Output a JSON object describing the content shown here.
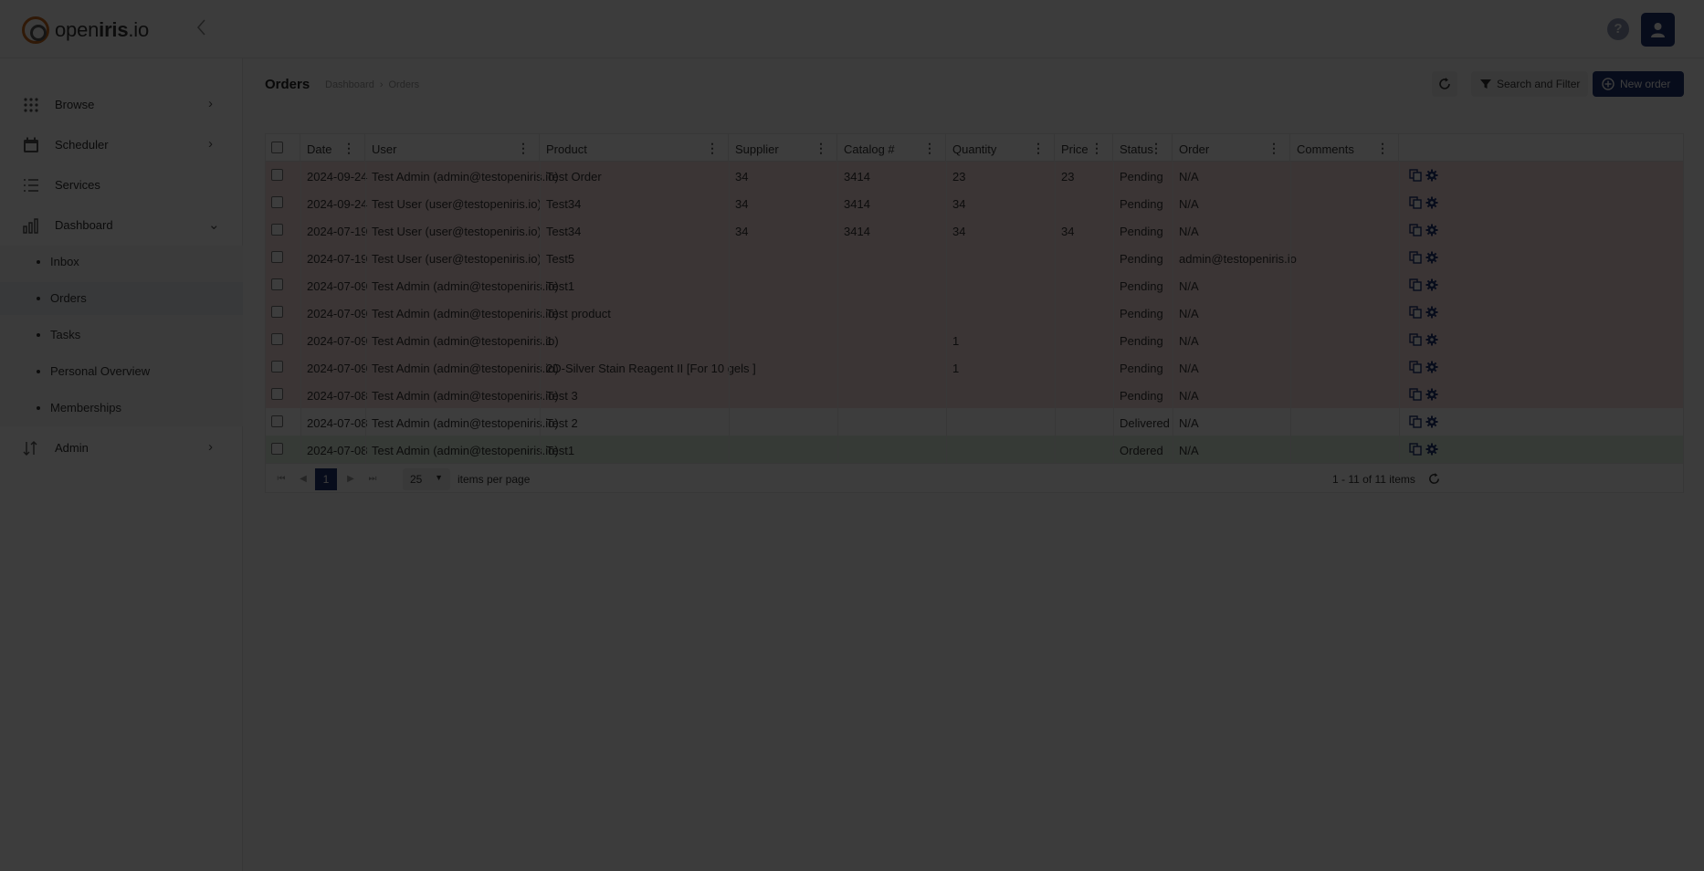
{
  "header": {
    "brand_light": "open",
    "brand_bold": "iris",
    "brand_suffix": ".io",
    "collapse_icon": "chevron-left-icon",
    "help_label": "?",
    "user_icon": "user-icon"
  },
  "sidebar": {
    "items": [
      {
        "label": "Browse",
        "icon": "grid-dots-icon",
        "chevron": "›"
      },
      {
        "label": "Scheduler",
        "icon": "calendar-icon",
        "chevron": "›"
      },
      {
        "label": "Services",
        "icon": "list-icon",
        "chevron": ""
      },
      {
        "label": "Dashboard",
        "icon": "bar-chart-icon",
        "chevron": "⌄"
      },
      {
        "label": "Admin",
        "icon": "sort-icon",
        "chevron": "›"
      }
    ],
    "dashboard_sub": [
      "Inbox",
      "Orders",
      "Tasks",
      "Personal Overview",
      "Memberships"
    ],
    "active_sub": "Orders"
  },
  "page": {
    "title": "Orders",
    "breadcrumb": [
      "Dashboard",
      "›",
      "Orders"
    ]
  },
  "toolbar": {
    "refresh_icon": "refresh-icon",
    "filter_label": "Search and Filter",
    "new_label": "New order"
  },
  "grid": {
    "columns": [
      "Date",
      "User",
      "Product",
      "Supplier",
      "Catalog #",
      "Quantity",
      "Price",
      "Status",
      "Order",
      "Comments"
    ],
    "rows": [
      {
        "date": "2024-09-24",
        "user": "Test Admin (admin@testopeniris.io)",
        "product": "Test Order",
        "supplier": "34",
        "catalog": "3414",
        "quantity": "23",
        "price": "23",
        "status": "Pending",
        "order": "N/A",
        "comments": ""
      },
      {
        "date": "2024-09-24",
        "user": "Test User (user@testopeniris.io)",
        "product": "Test34",
        "supplier": "34",
        "catalog": "3414",
        "quantity": "34",
        "price": "",
        "status": "Pending",
        "order": "N/A",
        "comments": ""
      },
      {
        "date": "2024-07-19",
        "user": "Test User (user@testopeniris.io)",
        "product": "Test34",
        "supplier": "34",
        "catalog": "3414",
        "quantity": "34",
        "price": "34",
        "status": "Pending",
        "order": "N/A",
        "comments": ""
      },
      {
        "date": "2024-07-19",
        "user": "Test User (user@testopeniris.io)",
        "product": "Test5",
        "supplier": "",
        "catalog": "",
        "quantity": "",
        "price": "",
        "status": "Pending",
        "order": "admin@testopeniris.io",
        "comments": ""
      },
      {
        "date": "2024-07-09",
        "user": "Test Admin (admin@testopeniris.io)",
        "product": "Test1",
        "supplier": "",
        "catalog": "",
        "quantity": "",
        "price": "",
        "status": "Pending",
        "order": "N/A",
        "comments": ""
      },
      {
        "date": "2024-07-09",
        "user": "Test Admin (admin@testopeniris.io)",
        "product": "Test product",
        "supplier": "",
        "catalog": "",
        "quantity": "",
        "price": "",
        "status": "Pending",
        "order": "N/A",
        "comments": ""
      },
      {
        "date": "2024-07-09",
        "user": "Test Admin (admin@testopeniris.io)",
        "product": "1",
        "supplier": "",
        "catalog": "",
        "quantity": "1",
        "price": "",
        "status": "Pending",
        "order": "N/A",
        "comments": ""
      },
      {
        "date": "2024-07-09",
        "user": "Test Admin (admin@testopeniris.io)",
        "product": "2D-Silver Stain Reagent II [For 10 gels ]",
        "supplier": "",
        "catalog": "",
        "quantity": "1",
        "price": "",
        "status": "Pending",
        "order": "N/A",
        "comments": ""
      },
      {
        "date": "2024-07-08",
        "user": "Test Admin (admin@testopeniris.io)",
        "product": "Test 3",
        "supplier": "",
        "catalog": "",
        "quantity": "",
        "price": "",
        "status": "Pending",
        "order": "N/A",
        "comments": ""
      },
      {
        "date": "2024-07-08",
        "user": "Test Admin (admin@testopeniris.io)",
        "product": "Test 2",
        "supplier": "",
        "catalog": "",
        "quantity": "",
        "price": "",
        "status": "Delivered",
        "order": "N/A",
        "comments": ""
      },
      {
        "date": "2024-07-08",
        "user": "Test Admin (admin@testopeniris.io)",
        "product": "Test1",
        "supplier": "",
        "catalog": "",
        "quantity": "",
        "price": "",
        "status": "Ordered",
        "order": "N/A",
        "comments": ""
      }
    ],
    "row_actions": [
      "copy-icon",
      "gear-icon"
    ]
  },
  "pager": {
    "first": "⏮",
    "prev": "◀",
    "current_page": "1",
    "next": "▶",
    "last": "⏭",
    "page_size": "25",
    "items_per_page_label": "items per page",
    "info": "1 - 11 of 11 items"
  },
  "colors": {
    "brand_navy": "#1f3573",
    "logo_orange": "#c76a21",
    "pending_row": "#f7dede",
    "ordered_row": "#e0f2df",
    "overlay": "rgba(0,0,0,0.76)"
  }
}
